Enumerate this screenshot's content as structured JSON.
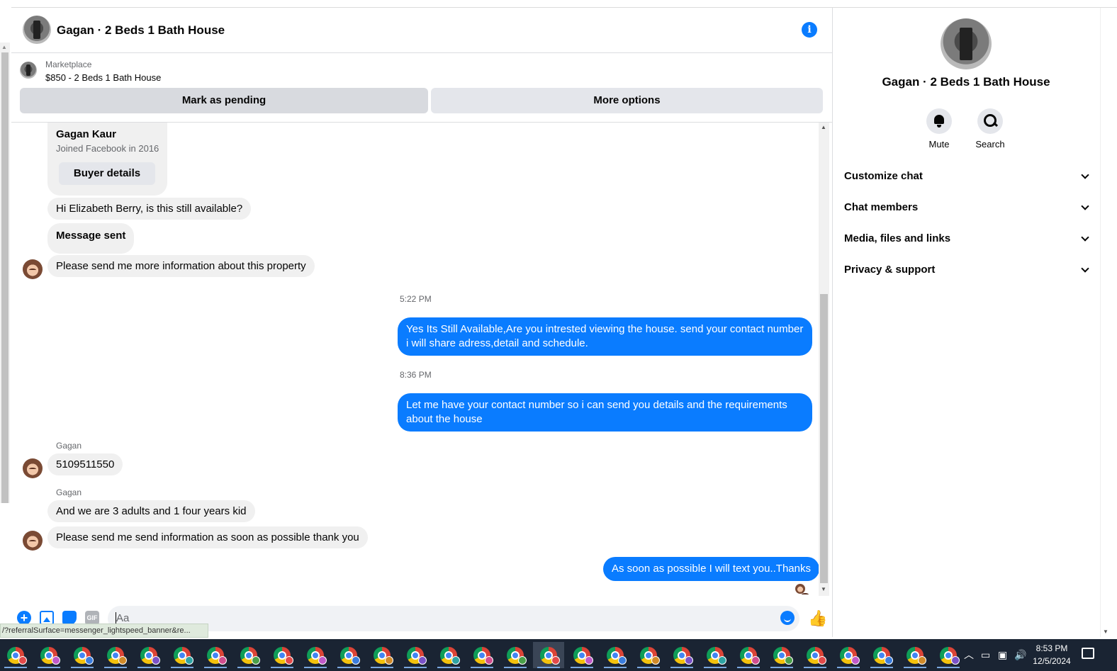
{
  "chat": {
    "title": "Gagan · 2 Beds 1 Bath House",
    "info_icon": "i"
  },
  "marketplace": {
    "label": "Marketplace",
    "item": "$850 - 2 Beds 1 Bath House",
    "mark_pending": "Mark as pending",
    "more_options": "More options"
  },
  "buyer_card": {
    "name": "Gagan Kaur",
    "joined": "Joined Facebook in 2016",
    "button": "Buyer details"
  },
  "messages": [
    {
      "text": "Hi Elizabeth Berry, is this still available?"
    },
    {
      "text": "Message sent"
    },
    {
      "text": "Please send me more information about this property"
    },
    {
      "time": "5:22 PM"
    },
    {
      "text": "Yes Its Still Available,Are you intrested viewing the house. send your contact number i will share adress,detail and schedule."
    },
    {
      "time": "8:36 PM"
    },
    {
      "text": "Let me have your contact number so i can send you details and the requirements about the house"
    },
    {
      "sender": "Gagan"
    },
    {
      "text": "5109511550"
    },
    {
      "sender": "Gagan"
    },
    {
      "text": "And we are 3 adults and 1 four years kid"
    },
    {
      "text": "Please send me send information as soon as possible thank you"
    },
    {
      "text": "As soon as possible I will text you..Thanks"
    }
  ],
  "composer": {
    "placeholder": "Aa",
    "gif_label": "GIF"
  },
  "status_url": "/?referralSurface=messenger_lightspeed_banner&re...",
  "right_panel": {
    "title": "Gagan · 2 Beds 1 Bath House",
    "mute": "Mute",
    "search": "Search",
    "sections": [
      "Customize chat",
      "Chat members",
      "Media, files and links",
      "Privacy & support"
    ]
  },
  "taskbar": {
    "time": "8:53 PM",
    "date": "12/5/2024",
    "app_count": 29
  },
  "colors": {
    "accent": "#0a7cff",
    "incoming_bubble": "#f0f0f0",
    "taskbar": "#1a2433"
  }
}
